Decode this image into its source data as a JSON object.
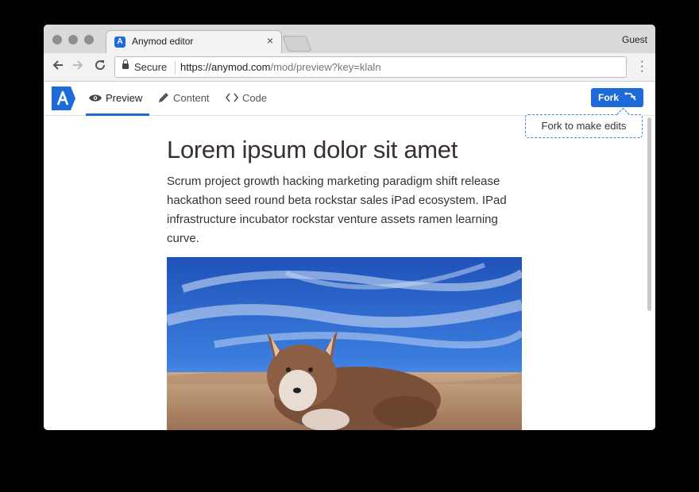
{
  "browser": {
    "tab_title": "Anymod editor",
    "tab_close": "×",
    "profile": "Guest",
    "secure_label": "Secure",
    "url_scheme": "https://",
    "url_host": "anymod.com",
    "url_path": "/mod/preview?key=klaln"
  },
  "app": {
    "logo_letter": "A",
    "tabs": [
      {
        "label": "Preview",
        "icon": "eye-icon"
      },
      {
        "label": "Content",
        "icon": "pencil-icon"
      },
      {
        "label": "Code",
        "icon": "code-icon"
      }
    ],
    "fork_label": "Fork",
    "fork_tooltip": "Fork to make edits"
  },
  "article": {
    "title": "Lorem ipsum dolor sit amet",
    "body": "Scrum project growth hacking marketing paradigm shift release hackathon seed round beta rockstar sales iPad ecosystem. IPad infrastructure incubator rockstar venture assets ramen learning curve."
  },
  "colors": {
    "accent": "#1e6ad8",
    "sky": "#2a66c9",
    "sand": "#b98e6c"
  }
}
